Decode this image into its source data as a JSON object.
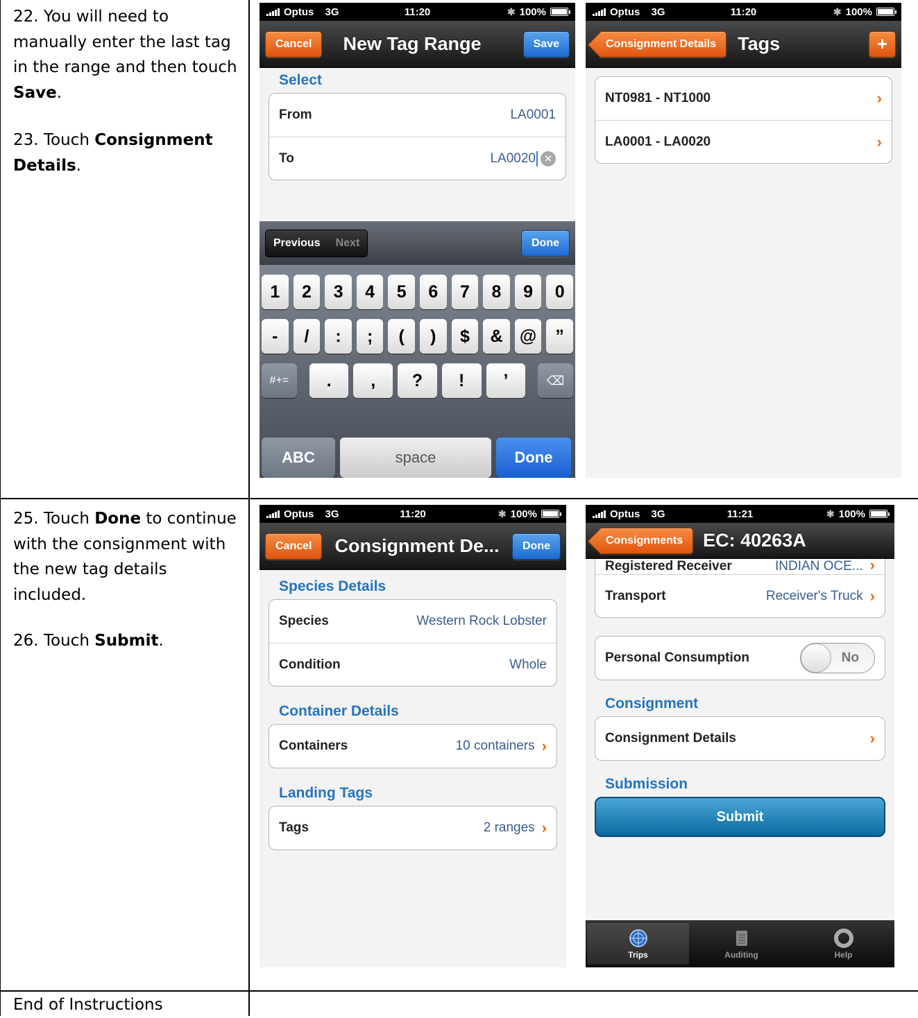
{
  "instructions": {
    "step22": {
      "pre": "22. You will need to manually enter the last tag in the range and then touch ",
      "bold": "Save",
      "post": "."
    },
    "step23": {
      "pre": "23. Touch ",
      "bold": "Consignment Details",
      "post": "."
    },
    "step25": {
      "pre": "25. Touch ",
      "bold": "Done",
      "post": " to continue with the consignment with the new tag details included."
    },
    "step26": {
      "pre": "26. Touch ",
      "bold": "Submit",
      "post": "."
    },
    "end": "End of Instructions"
  },
  "status_a": {
    "carrier": "Optus",
    "network": "3G",
    "time": "11:20",
    "battery": "100%"
  },
  "status_d": {
    "carrier": "Optus",
    "network": "3G",
    "time": "11:21",
    "battery": "100%"
  },
  "screen1": {
    "cancel": "Cancel",
    "title": "New Tag Range",
    "save": "Save",
    "section": "Select",
    "from_label": "From",
    "from_value": "LA0001",
    "to_label": "To",
    "to_value": "LA0020",
    "previous": "Previous",
    "next": "Next",
    "done": "Done",
    "keys_row1": [
      "1",
      "2",
      "3",
      "4",
      "5",
      "6",
      "7",
      "8",
      "9",
      "0"
    ],
    "keys_row2": [
      "-",
      "/",
      ":",
      ";",
      "(",
      ")",
      "$",
      "&",
      "@",
      "”"
    ],
    "keys_row3": [
      ".",
      ",",
      "?",
      "!",
      "’"
    ],
    "symbols": "#+=",
    "abc": "ABC",
    "space": "space",
    "done_key": "Done"
  },
  "screen2": {
    "back": "Consignment Details",
    "title": "Tags",
    "ranges": [
      "NT0981 - NT1000",
      "LA0001 - LA0020"
    ]
  },
  "screen3": {
    "cancel": "Cancel",
    "title": "Consignment De...",
    "done": "Done",
    "species_section": "Species Details",
    "species_label": "Species",
    "species_value": "Western Rock Lobster",
    "condition_label": "Condition",
    "condition_value": "Whole",
    "container_section": "Container Details",
    "containers_label": "Containers",
    "containers_value": "10 containers",
    "landing_section": "Landing Tags",
    "tags_label": "Tags",
    "tags_value": "2 ranges"
  },
  "screen4": {
    "back": "Consignments",
    "title": "EC: 40263A",
    "cutoff_label": "Registered Receiver",
    "cutoff_value": "INDIAN OCE...",
    "transport_label": "Transport",
    "transport_value": "Receiver's Truck",
    "personal_label": "Personal Consumption",
    "toggle_value": "No",
    "consignment_section": "Consignment",
    "consignment_details": "Consignment Details",
    "submission_section": "Submission",
    "submit": "Submit",
    "tabs": [
      "Trips",
      "Auditing",
      "Help"
    ]
  },
  "colors": {
    "accent_orange": "#e86a12",
    "ios_blue": "#2474be",
    "submit_blue": "#0a6aa0"
  }
}
